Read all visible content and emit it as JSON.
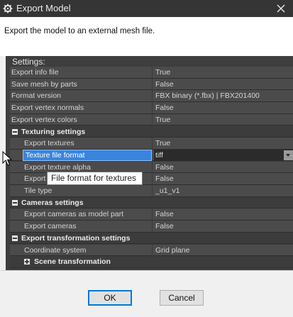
{
  "window": {
    "title": "Export Model",
    "description": "Export the model to an external mesh file."
  },
  "settings": {
    "label": "Settings:",
    "rows": [
      {
        "kind": "prop",
        "indent": 0,
        "name": "Export info file",
        "value": "True"
      },
      {
        "kind": "prop",
        "indent": 0,
        "name": "Save mesh by parts",
        "value": "False"
      },
      {
        "kind": "prop",
        "indent": 0,
        "name": "Format version",
        "value": "FBX binary (*.fbx) | FBX201400"
      },
      {
        "kind": "prop",
        "indent": 0,
        "name": "Export vertex normals",
        "value": "False"
      },
      {
        "kind": "prop",
        "indent": 0,
        "name": "Export vertex colors",
        "value": "True"
      },
      {
        "kind": "group",
        "name": "Texturing settings"
      },
      {
        "kind": "prop",
        "indent": 1,
        "name": "Export textures",
        "value": "True"
      },
      {
        "kind": "prop",
        "indent": 1,
        "name": "Texture file format",
        "value": "tiff",
        "selected": true
      },
      {
        "kind": "prop",
        "indent": 1,
        "name": "Export texture alpha",
        "value": "False"
      },
      {
        "kind": "prop",
        "indent": 1,
        "name": "Export",
        "value": "False"
      },
      {
        "kind": "prop",
        "indent": 1,
        "name": "Tile type",
        "value": "_u1_v1"
      },
      {
        "kind": "group",
        "name": "Cameras settings"
      },
      {
        "kind": "prop",
        "indent": 1,
        "name": "Export cameras as model part",
        "value": "False"
      },
      {
        "kind": "prop",
        "indent": 1,
        "name": "Export cameras",
        "value": "False"
      },
      {
        "kind": "group",
        "name": "Export transformation settings"
      },
      {
        "kind": "prop",
        "indent": 1,
        "name": "Coordinate system",
        "value": "Grid plane"
      },
      {
        "kind": "subgroup",
        "name": "Scene transformation"
      }
    ]
  },
  "tooltip": "File format for textures",
  "buttons": {
    "ok": "OK",
    "cancel": "Cancel"
  },
  "colors": {
    "selection": "#3a84dc",
    "focus_border": "#0078d7",
    "titlebar": "#353535"
  },
  "icons": {
    "app": "gear-icon",
    "close": "close-icon",
    "cursor": "mouse-pointer-icon"
  }
}
